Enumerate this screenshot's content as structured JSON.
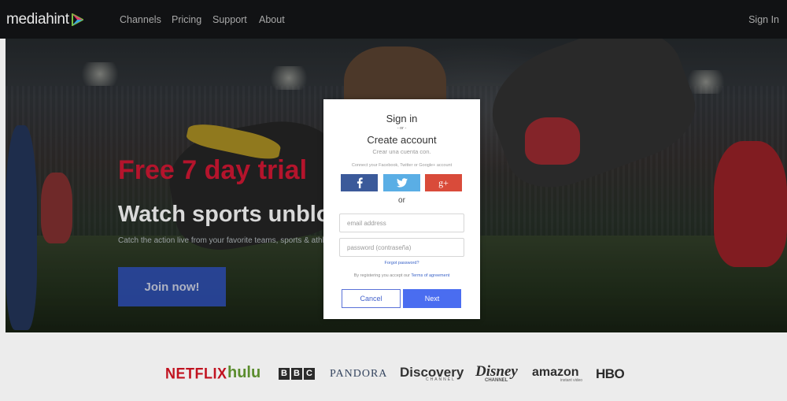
{
  "nav": {
    "logo": "mediahint",
    "links": [
      "Channels",
      "Pricing",
      "Support",
      "About"
    ],
    "signin": "Sign In"
  },
  "hero": {
    "headline": "Free 7 day trial",
    "subheadline": "Watch sports unblocked",
    "tagline": "Catch the action live from your favorite teams, sports & athletes",
    "cta": "Join now!"
  },
  "modal": {
    "title": "Sign in",
    "or_small": "- or -",
    "create": "Create account",
    "create_es": "Crear una cuenta con.",
    "connect_text": "Connect your Facebook, Twitter or Google+ account",
    "social": [
      {
        "name": "facebook",
        "glyph": "f",
        "color": "#3b5a9a"
      },
      {
        "name": "twitter",
        "glyph": "twitter",
        "color": "#5aaee5"
      },
      {
        "name": "google-plus",
        "glyph": "g+",
        "color": "#d94b3a"
      }
    ],
    "or": "or",
    "email_placeholder": "email address",
    "password_placeholder": "password (contraseña)",
    "forgot": "Forgot password?",
    "register_prefix": "By registering you accept our",
    "terms": "Terms of agreement",
    "cancel": "Cancel",
    "next": "Next"
  },
  "brands": {
    "netflix": "NETFLIX",
    "hulu": "hulu",
    "bbc": [
      "B",
      "B",
      "C"
    ],
    "pandora": "PANDORA",
    "discovery": "Discovery",
    "discovery_sub": "CHANNEL",
    "disney": "Disney",
    "disney_sub": "CHANNEL",
    "amazon": "amazon",
    "amazon_sub": "instant video",
    "hbo": "HBO"
  },
  "colors": {
    "nav_bg": "#111214",
    "headline_red": "#b4142c",
    "cta_blue": "#2a48a8",
    "next_blue": "#4a6df0",
    "facebook": "#3b5a9a",
    "twitter": "#5aaee5",
    "google": "#d94b3a"
  }
}
